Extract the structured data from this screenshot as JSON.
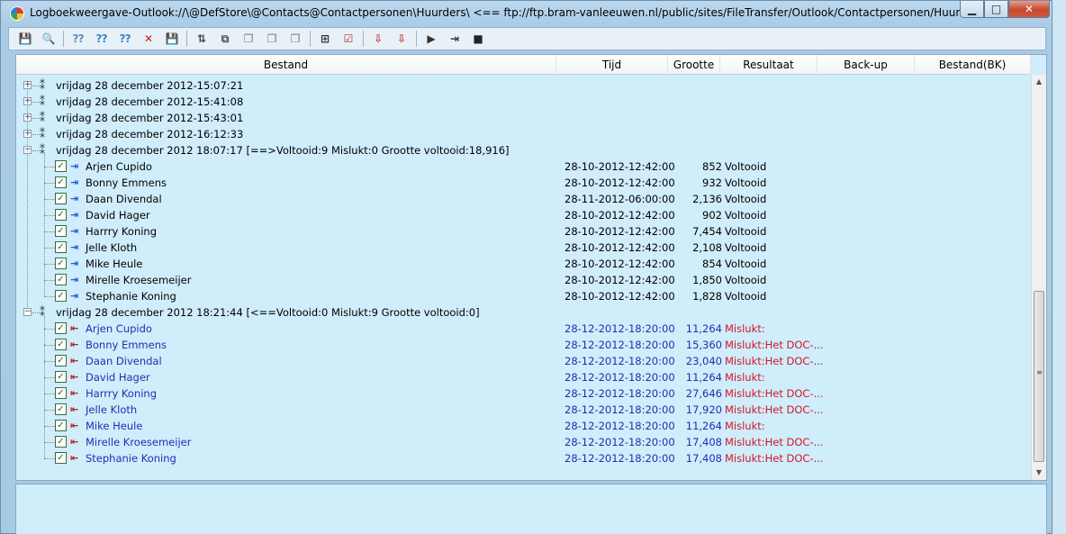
{
  "window": {
    "title": "Logboekweergave-Outlook://\\@DefStore\\@Contacts@Contactpersonen\\Huurders\\ <== ftp://ftp.bram-vanleeuwen.nl/public/sites/FileTransfer/Outlook/Contactpersonen/Huurders/",
    "min_glyph": "▁",
    "max_glyph": "□",
    "close_glyph": "✕"
  },
  "toolbar": {
    "buttons": [
      {
        "icon": "save-icon",
        "glyph": "💾"
      },
      {
        "icon": "search-icon",
        "glyph": "🔍"
      },
      {
        "icon": "find-icon",
        "glyph": "⁇"
      },
      {
        "icon": "find-next-icon",
        "glyph": "⁇"
      },
      {
        "icon": "find-prev-icon",
        "glyph": "⁇"
      },
      {
        "icon": "delete-icon",
        "glyph": "✕"
      },
      {
        "icon": "disk-icon",
        "glyph": "💾"
      },
      {
        "icon": "sort-icon",
        "glyph": "⇅"
      },
      {
        "icon": "filter-icon",
        "glyph": "⧉"
      },
      {
        "icon": "copy-icon",
        "glyph": "❐"
      },
      {
        "icon": "copy-all-icon",
        "glyph": "❐"
      },
      {
        "icon": "paste-icon",
        "glyph": "❐"
      },
      {
        "icon": "tree-icon",
        "glyph": "⊞"
      },
      {
        "icon": "select-all-icon",
        "glyph": "☑"
      },
      {
        "icon": "download-icon",
        "glyph": "⇩"
      },
      {
        "icon": "download-all-icon",
        "glyph": "⇩"
      },
      {
        "icon": "play-icon",
        "glyph": "▶"
      },
      {
        "icon": "skip-icon",
        "glyph": "⇥"
      },
      {
        "icon": "stop-icon",
        "glyph": "■"
      }
    ]
  },
  "columns": [
    "Bestand",
    "Tijd",
    "Grootte",
    "Resultaat",
    "Back-up",
    "Bestand(BK)"
  ],
  "collapsed_groups": [
    "vrijdag 28 december 2012-15:07:21",
    "vrijdag 28 december 2012-15:41:08",
    "vrijdag 28 december 2012-15:43:01",
    "vrijdag 28 december 2012-16:12:33"
  ],
  "group1": {
    "label": "vrijdag 28 december 2012 18:07:17 [==>Voltooid:9 Mislukt:0 Grootte voltooid:18,916]",
    "rows": [
      {
        "name": "Arjen Cupido",
        "time": "28-10-2012-12:42:00",
        "size": "852",
        "result": "Voltooid"
      },
      {
        "name": "Bonny Emmens",
        "time": "28-10-2012-12:42:00",
        "size": "932",
        "result": "Voltooid"
      },
      {
        "name": "Daan Divendal",
        "time": "28-11-2012-06:00:00",
        "size": "2,136",
        "result": "Voltooid"
      },
      {
        "name": "David Hager",
        "time": "28-10-2012-12:42:00",
        "size": "902",
        "result": "Voltooid"
      },
      {
        "name": "Harrry Koning",
        "time": "28-10-2012-12:42:00",
        "size": "7,454",
        "result": "Voltooid"
      },
      {
        "name": "Jelle Kloth",
        "time": "28-10-2012-12:42:00",
        "size": "2,108",
        "result": "Voltooid"
      },
      {
        "name": "Mike Heule",
        "time": "28-10-2012-12:42:00",
        "size": "854",
        "result": "Voltooid"
      },
      {
        "name": "Mirelle Kroesemeijer",
        "time": "28-10-2012-12:42:00",
        "size": "1,850",
        "result": "Voltooid"
      },
      {
        "name": "Stephanie Koning",
        "time": "28-10-2012-12:42:00",
        "size": "1,828",
        "result": "Voltooid"
      }
    ]
  },
  "group2": {
    "label": "vrijdag 28 december 2012 18:21:44 [<==Voltooid:0 Mislukt:9 Grootte voltooid:0]",
    "rows": [
      {
        "name": "Arjen Cupido",
        "time": "28-12-2012-18:20:00",
        "size": "11,264",
        "result": "Mislukt:"
      },
      {
        "name": "Bonny Emmens",
        "time": "28-12-2012-18:20:00",
        "size": "15,360",
        "result": "Mislukt:Het DOC-..."
      },
      {
        "name": "Daan Divendal",
        "time": "28-12-2012-18:20:00",
        "size": "23,040",
        "result": "Mislukt:Het DOC-..."
      },
      {
        "name": "David Hager",
        "time": "28-12-2012-18:20:00",
        "size": "11,264",
        "result": "Mislukt:"
      },
      {
        "name": "Harrry Koning",
        "time": "28-12-2012-18:20:00",
        "size": "27,646",
        "result": "Mislukt:Het DOC-..."
      },
      {
        "name": "Jelle Kloth",
        "time": "28-12-2012-18:20:00",
        "size": "17,920",
        "result": "Mislukt:Het DOC-..."
      },
      {
        "name": "Mike Heule",
        "time": "28-12-2012-18:20:00",
        "size": "11,264",
        "result": "Mislukt:"
      },
      {
        "name": "Mirelle Kroesemeijer",
        "time": "28-12-2012-18:20:00",
        "size": "17,408",
        "result": "Mislukt:Het DOC-..."
      },
      {
        "name": "Stephanie Koning",
        "time": "28-12-2012-18:20:00",
        "size": "17,408",
        "result": "Mislukt:Het DOC-..."
      }
    ]
  },
  "colors": {
    "panel_bg": "#cfedfb",
    "failed_text": "#1e2fb0",
    "failed_result": "#d1162a"
  }
}
